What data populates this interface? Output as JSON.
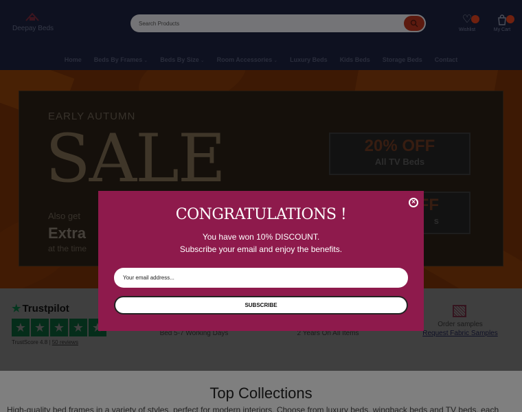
{
  "brand": {
    "name": "Deepay Beds",
    "accent": "#b8351f"
  },
  "search": {
    "placeholder": "Search Products"
  },
  "header_actions": {
    "wishlist": "Wishlist",
    "cart": "My Cart"
  },
  "nav": [
    {
      "label": "Home",
      "dropdown": false
    },
    {
      "label": "Beds By Frames",
      "dropdown": true
    },
    {
      "label": "Beds By Size",
      "dropdown": true
    },
    {
      "label": "Room Accessories",
      "dropdown": true
    },
    {
      "label": "Luxury Beds",
      "dropdown": false
    },
    {
      "label": "Kids Beds",
      "dropdown": false
    },
    {
      "label": "Storage Beds",
      "dropdown": false
    },
    {
      "label": "Contact",
      "dropdown": false
    }
  ],
  "hero": {
    "kicker": "EARLY AUTUMN",
    "headline": "SALE",
    "also": "Also get",
    "extra": "Extra",
    "time": "at the time",
    "offers": [
      {
        "top": "20% OFF",
        "sub": "All TV Beds"
      },
      {
        "top": "FF",
        "sub": "s"
      }
    ]
  },
  "trustpilot": {
    "name": "Trustpilot",
    "score_label": "TrustScore 4.8",
    "reviews": "50 reviews",
    "rating_stars": 5
  },
  "features": [
    {
      "text": "Bed 5-7 Working Days"
    },
    {
      "text": "2 Years On All Items"
    },
    {
      "title": "Order samples",
      "link": "Request Fabric Samples",
      "icon": "fabric-swatch-icon"
    }
  ],
  "collections": {
    "title": "Top Collections",
    "description": "High-quality bed frames in a variety of styles, perfect for modern interiors. Choose from luxury beds, wingback beds and TV beds, each"
  },
  "popup": {
    "title": "CONGRATULATIONS !",
    "line1": "You have won 10% DISCOUNT.",
    "line2": "Subscribe your email and enjoy the benefits.",
    "email_placeholder": "Your email address...",
    "button": "SUBSCRIBE",
    "background": "#8e1a4c",
    "close_icon": "close-circle-icon"
  }
}
